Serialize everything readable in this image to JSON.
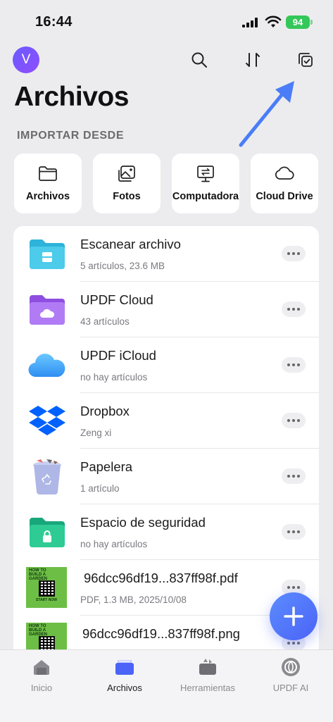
{
  "status": {
    "time": "16:44",
    "battery": "94"
  },
  "header": {
    "avatar_initial": "V",
    "title": "Archivos",
    "import_label": "IMPORTAR DESDE"
  },
  "import_sources": [
    {
      "label": "Archivos",
      "icon": "folder-icon"
    },
    {
      "label": "Fotos",
      "icon": "photos-icon"
    },
    {
      "label": "Computadora",
      "icon": "computer-icon"
    },
    {
      "label": "Cloud Drive",
      "icon": "cloud-icon"
    }
  ],
  "files": [
    {
      "title": "Escanear archivo",
      "subtitle": "5 artículos, 23.6 MB",
      "icon": "scan-folder-icon"
    },
    {
      "title": "UPDF Cloud",
      "subtitle": "43 artículos",
      "icon": "cloud-folder-icon"
    },
    {
      "title": "UPDF iCloud",
      "subtitle": "no hay artículos",
      "icon": "icloud-icon"
    },
    {
      "title": "Dropbox",
      "subtitle": "Zeng xi",
      "icon": "dropbox-icon"
    },
    {
      "title": "Papelera",
      "subtitle": "1 artículo",
      "icon": "trash-icon"
    },
    {
      "title": "Espacio de seguridad",
      "subtitle": "no hay artículos",
      "icon": "lock-folder-icon"
    },
    {
      "title": "96dcc96df19...837ff98f.pdf",
      "subtitle": "PDF, 1.3 MB, 2025/10/08",
      "icon": "pdf-thumbnail",
      "thumb_text": {
        "line1": "HOW TO",
        "line2": "BUILD A",
        "line3": "GARDEN",
        "line4": "START NOW"
      }
    },
    {
      "title": "96dcc96df19...837ff98f.png",
      "subtitle": "",
      "icon": "png-thumbnail",
      "thumb_text": {
        "line1": "HOW TO",
        "line2": "BUILD A",
        "line3": "GARDEN"
      }
    }
  ],
  "tabs": [
    {
      "label": "Inicio",
      "icon": "home-icon",
      "active": false
    },
    {
      "label": "Archivos",
      "icon": "files-icon",
      "active": true
    },
    {
      "label": "Herramientas",
      "icon": "tools-icon",
      "active": false
    },
    {
      "label": "UPDF AI",
      "icon": "ai-icon",
      "active": false
    }
  ],
  "colors": {
    "accent": "#4B63F6",
    "background": "#ECECEF",
    "annotation_arrow": "#4A7DF7"
  }
}
